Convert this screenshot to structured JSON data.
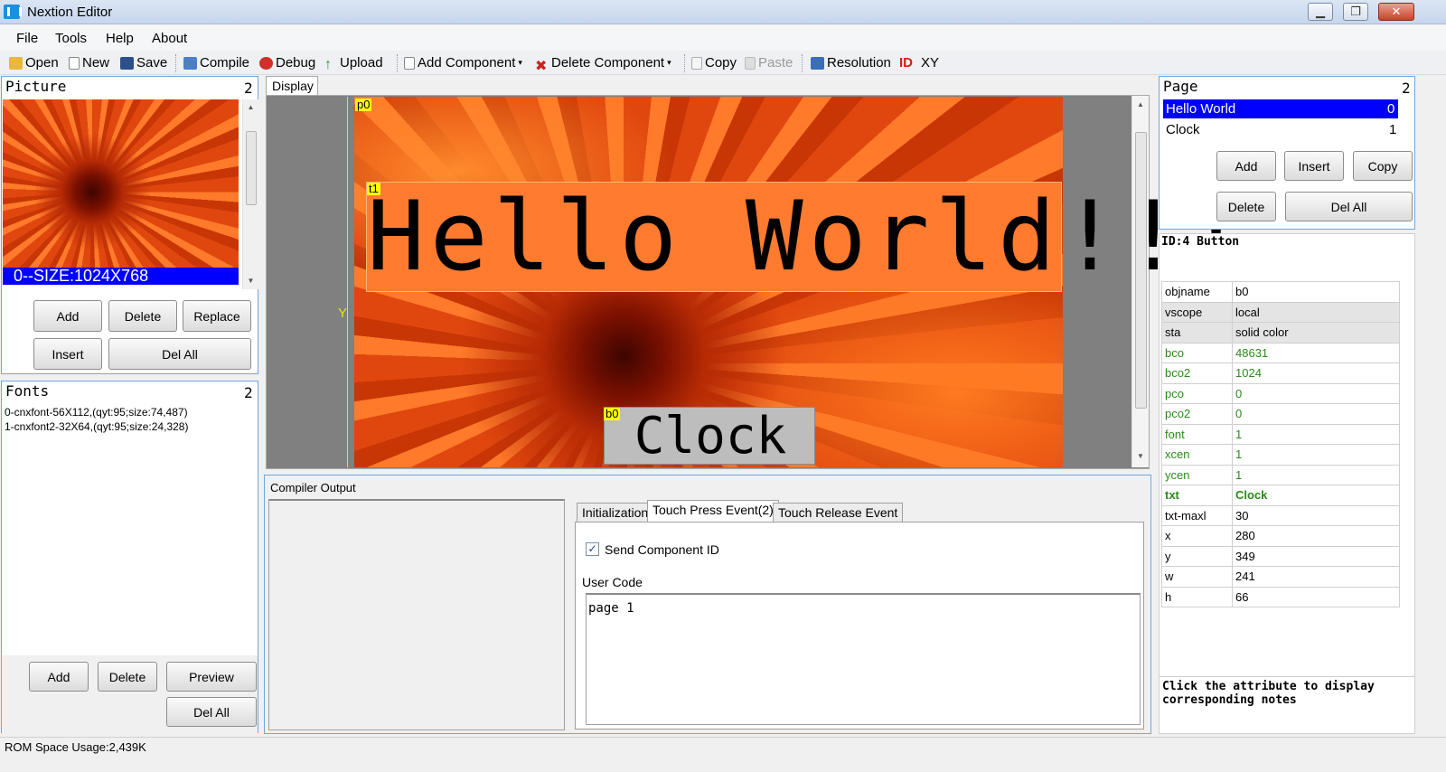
{
  "window": {
    "title": "Nextion Editor",
    "controls": {
      "minimize": "▁",
      "maximize": "❐",
      "close": "✕"
    }
  },
  "menu": [
    "File",
    "Tools",
    "Help",
    "About"
  ],
  "toolbar": {
    "open": "Open",
    "new": "New",
    "save": "Save",
    "compile": "Compile",
    "debug": "Debug",
    "upload": "Upload",
    "add_component": "Add Component",
    "delete_component": "Delete Component",
    "copy": "Copy",
    "paste": "Paste",
    "resolution": "Resolution",
    "id": "ID",
    "xy": "XY"
  },
  "picture_panel": {
    "title": "Picture",
    "count": "2",
    "caption": "0--SIZE:1024X768",
    "buttons": {
      "add": "Add",
      "delete": "Delete",
      "replace": "Replace",
      "insert": "Insert",
      "del_all": "Del All"
    }
  },
  "fonts_panel": {
    "title": "Fonts",
    "count": "2",
    "items": [
      "0-cnxfont-56X112,(qyt:95;size:74,487)",
      "1-cnxfont2-32X64,(qyt:95;size:24,328)"
    ],
    "buttons": {
      "add": "Add",
      "delete": "Delete",
      "preview": "Preview",
      "del_all": "Del All"
    }
  },
  "display": {
    "tab": "Display",
    "y_label": "Y",
    "p0_tag": "p0",
    "t1_tag": "t1",
    "t1_text": "Hello World!!!",
    "b0_tag": "b0",
    "b0_text": "Clock"
  },
  "compiler": {
    "title": "Compiler Output",
    "tabs": [
      "Initialization",
      "Touch Press Event(2)",
      "Touch Release Event"
    ],
    "send_component_id": "Send Component ID",
    "send_checked": true,
    "user_code_label": "User Code",
    "user_code": "page 1"
  },
  "page_panel": {
    "title": "Page",
    "count": "2",
    "pages": [
      {
        "name": "Hello World",
        "index": "0"
      },
      {
        "name": "Clock",
        "index": "1"
      }
    ],
    "buttons": {
      "add": "Add",
      "insert": "Insert",
      "copy": "Copy",
      "delete": "Delete",
      "del_all": "Del All"
    }
  },
  "attributes": {
    "header": "ID:4 Button",
    "rows": [
      {
        "key": "objname",
        "value": "b0",
        "style": "white"
      },
      {
        "key": "vscope",
        "value": "local",
        "style": "gray"
      },
      {
        "key": "sta",
        "value": "solid color",
        "style": "gray"
      },
      {
        "key": "bco",
        "value": "48631",
        "style": "green"
      },
      {
        "key": "bco2",
        "value": "1024",
        "style": "green"
      },
      {
        "key": "pco",
        "value": "0",
        "style": "green"
      },
      {
        "key": "pco2",
        "value": "0",
        "style": "green"
      },
      {
        "key": "font",
        "value": "1",
        "style": "green"
      },
      {
        "key": "xcen",
        "value": "1",
        "style": "green"
      },
      {
        "key": "ycen",
        "value": "1",
        "style": "green"
      },
      {
        "key": "txt",
        "value": "Clock",
        "style": "green bold"
      },
      {
        "key": "txt-maxl",
        "value": "30",
        "style": "white"
      },
      {
        "key": "x",
        "value": "280",
        "style": "white"
      },
      {
        "key": "y",
        "value": "349",
        "style": "white"
      },
      {
        "key": "w",
        "value": "241",
        "style": "white"
      },
      {
        "key": "h",
        "value": "66",
        "style": "white"
      }
    ],
    "note": "Click the attribute to display corresponding notes"
  },
  "status": {
    "rom_usage": "ROM Space Usage:2,439K"
  },
  "colors": {
    "selection": "#0000ff",
    "panel_border": "#6fa8dc",
    "tag_yellow": "#ffff00",
    "attr_green": "#2a8a1a"
  }
}
